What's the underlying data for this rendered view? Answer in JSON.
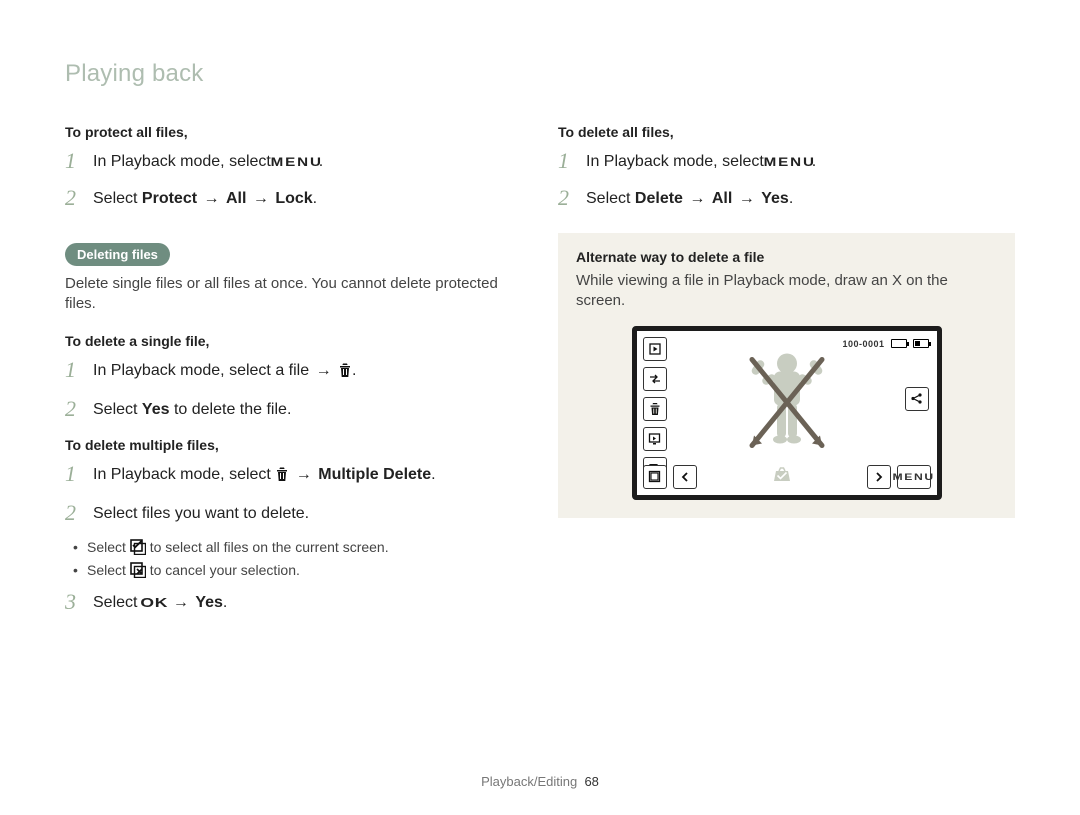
{
  "section_title": "Playing back",
  "left": {
    "protect_all": {
      "title": "To protect all files,",
      "s1_a": "In Playback mode, select",
      "s1_b": ".",
      "s2_a": "Select",
      "s2_b": "Protect",
      "s2_c": "All",
      "s2_d": "Lock",
      "s2_e": "."
    },
    "deleting": {
      "pill": "Deleting files",
      "intro": "Delete single files or all files at once. You cannot delete protected files."
    },
    "delete_single": {
      "title": "To delete a single file,",
      "s1_a": "In Playback mode, select a file",
      "s1_b": ".",
      "s2_a": "Select",
      "s2_b": "Yes",
      "s2_c": "to delete the file."
    },
    "delete_multi": {
      "title": "To delete multiple files,",
      "s1_a": "In Playback mode, select",
      "s1_b": "Multiple Delete",
      "s1_c": ".",
      "s2": "Select files you want to delete.",
      "b1_a": "Select",
      "b1_b": "to select all files on the current screen.",
      "b2_a": "Select",
      "b2_b": "to cancel your selection.",
      "s3_a": "Select",
      "s3_b": "Yes",
      "s3_c": "."
    }
  },
  "right": {
    "delete_all": {
      "title": "To delete all files,",
      "s1_a": "In Playback mode, select",
      "s1_b": ".",
      "s2_a": "Select",
      "s2_b": "Delete",
      "s2_c": "All",
      "s2_d": "Yes",
      "s2_e": "."
    },
    "note": {
      "title": "Alternate way to delete a file",
      "body": "While viewing a file in Playback mode, draw an X on the screen.",
      "file_counter": "100-0001"
    }
  },
  "arrow": "→",
  "icons": {
    "menu": "MENU",
    "ok": "OK"
  },
  "footer": {
    "label": "Playback/Editing",
    "page": "68"
  }
}
